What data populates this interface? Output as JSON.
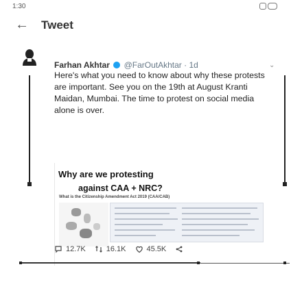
{
  "status_bar": {
    "time": "1:30",
    "icons": [
      "signal-icon",
      "battery-icon"
    ]
  },
  "header": {
    "back_icon": "back-arrow-icon",
    "back_glyph": "←",
    "title": "Tweet"
  },
  "tweet": {
    "author_name": "Farhan Akhtar",
    "handle": "@FarOutAkhtar",
    "separator": "·",
    "time": "1d",
    "caret_glyph": "⌄",
    "text": "Here's what you need to know about why these protests are important. See you on the 19th at August Kranti Maidan, Mumbai. The time to protest on social media alone is over.",
    "card": {
      "title_line1": "Why are we protesting",
      "title_line2": "against CAA + NRC?",
      "subtitle": "What is the Citizenship Amendment Act 2019 (CAA/CAB)"
    },
    "actions": {
      "replies": "12.7K",
      "retweets": "16.1K",
      "likes": "45.5K"
    }
  },
  "colors": {
    "verified": "#1da1f2",
    "text": "#14171a",
    "muted": "#657786"
  }
}
